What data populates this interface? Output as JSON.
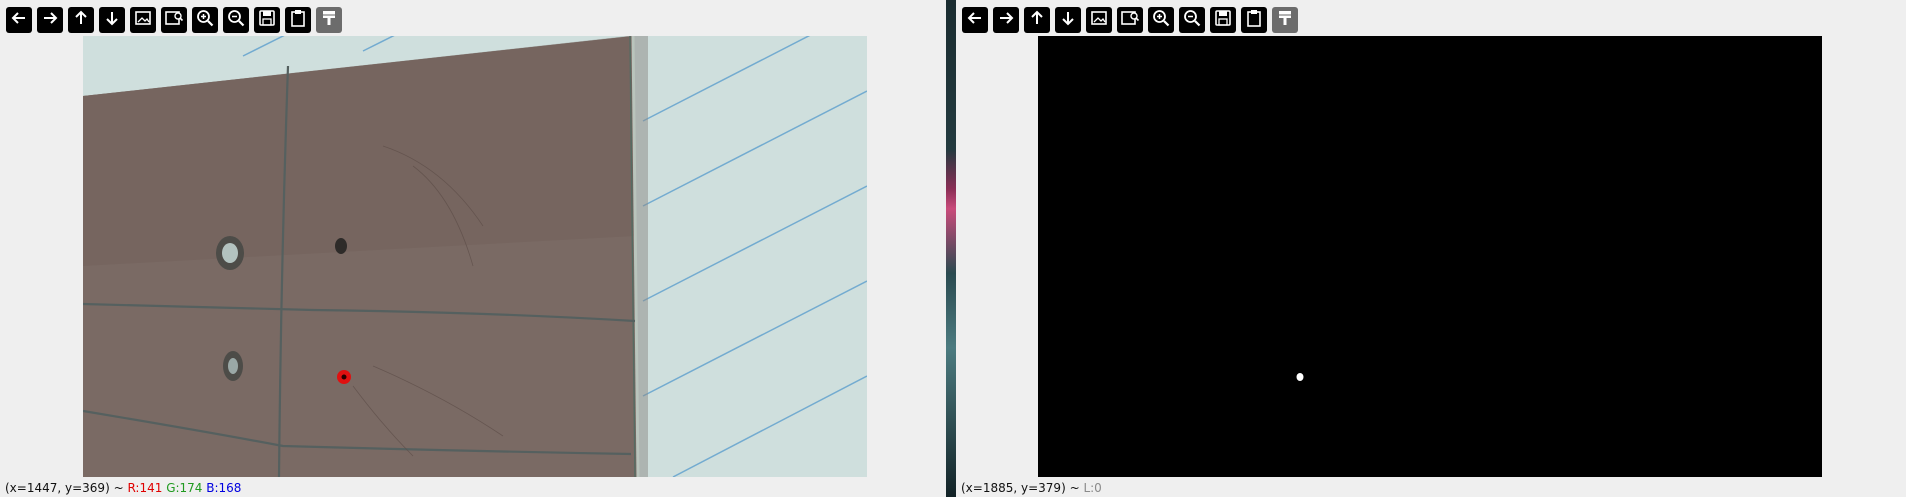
{
  "toolbar_buttons": [
    {
      "name": "back-button",
      "icon": "arrow-left-icon",
      "enabled": true
    },
    {
      "name": "forward-button",
      "icon": "arrow-right-icon",
      "enabled": true
    },
    {
      "name": "pan-up-button",
      "icon": "arrow-up-icon",
      "enabled": true
    },
    {
      "name": "pan-down-button",
      "icon": "arrow-down-icon",
      "enabled": true
    },
    {
      "name": "zoom-fit-button",
      "icon": "image-icon",
      "enabled": true
    },
    {
      "name": "zoom-original-button",
      "icon": "image-zoom-icon",
      "enabled": true
    },
    {
      "name": "zoom-in-button",
      "icon": "zoom-in-icon",
      "enabled": true
    },
    {
      "name": "zoom-out-button",
      "icon": "zoom-out-icon",
      "enabled": true
    },
    {
      "name": "save-button",
      "icon": "save-icon",
      "enabled": true
    },
    {
      "name": "copy-button",
      "icon": "clipboard-icon",
      "enabled": true
    },
    {
      "name": "properties-button",
      "icon": "paint-brush-icon",
      "enabled": false
    }
  ],
  "left_window": {
    "status": {
      "coords": "(x=1447, y=369) ~ ",
      "r": "R:141",
      "g": "G:174",
      "b": "B:168"
    }
  },
  "right_window": {
    "status": {
      "coords": "(x=1885, y=379) ~ ",
      "l": "L:0"
    }
  },
  "colors": {
    "marker": "#e01010",
    "panel_bg": "#efefef",
    "mask_bg": "#000000"
  }
}
